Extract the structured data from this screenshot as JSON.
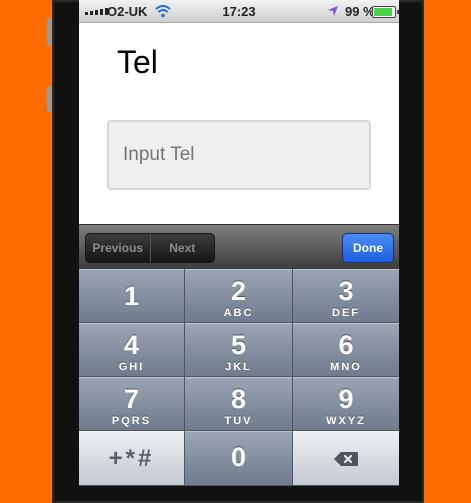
{
  "status_bar": {
    "carrier": "O2-UK",
    "time": "17:23",
    "battery_percent": "99 %",
    "battery_level": 0.99,
    "icons": [
      "signal-icon",
      "wifi-icon",
      "location-arrow-icon",
      "battery-icon"
    ]
  },
  "page": {
    "title": "Tel",
    "input_placeholder": "Input Tel",
    "input_value": ""
  },
  "toolbar": {
    "previous_label": "Previous",
    "next_label": "Next",
    "done_label": "Done"
  },
  "keypad": {
    "keys": [
      {
        "num": "1",
        "letters": ""
      },
      {
        "num": "2",
        "letters": "ABC"
      },
      {
        "num": "3",
        "letters": "DEF"
      },
      {
        "num": "4",
        "letters": "GHI"
      },
      {
        "num": "5",
        "letters": "JKL"
      },
      {
        "num": "6",
        "letters": "MNO"
      },
      {
        "num": "7",
        "letters": "PQRS"
      },
      {
        "num": "8",
        "letters": "TUV"
      },
      {
        "num": "9",
        "letters": "WXYZ"
      }
    ],
    "symbols_label": "+*#",
    "zero": "0",
    "backspace_icon": "backspace-icon"
  },
  "colors": {
    "background": "#ff6d00",
    "done_button": "#2a6be6",
    "keypad_key": "#7f8a99"
  }
}
